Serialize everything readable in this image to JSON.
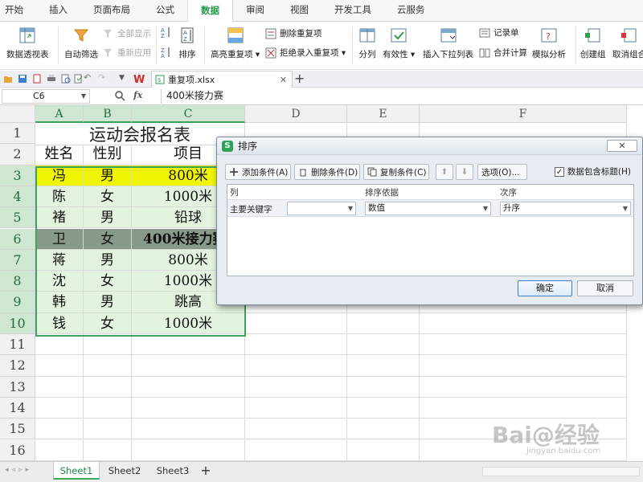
{
  "ribbon_tabs": [
    "开始",
    "插入",
    "页面布局",
    "公式",
    "数据",
    "审阅",
    "视图",
    "开发工具",
    "云服务"
  ],
  "ribbon": {
    "pivot": "数据透视表",
    "autofilter": "自动筛选",
    "show_all": "全部显示",
    "reapply": "重新应用",
    "sort": "排序",
    "highlight_dup": "高亮重复项",
    "delete_dup": "删除重复项",
    "reject_dup": "拒绝录入重复项",
    "split": "分列",
    "validity": "有效性",
    "dropdown_list": "插入下拉列表",
    "record": "记录单",
    "consolidate": "合并计算",
    "simulate": "模拟分析",
    "create_group": "创建组",
    "ungroup": "取消组合"
  },
  "document": {
    "tab_name": "重复项.xlsx"
  },
  "formula_bar": {
    "cell_ref": "C6",
    "fx": "fx",
    "value": "400米接力赛"
  },
  "sheet": {
    "columns": [
      "A",
      "B",
      "C",
      "D",
      "E",
      "F"
    ],
    "rows": [
      "1",
      "2",
      "3",
      "4",
      "5",
      "6",
      "7",
      "8",
      "9",
      "10",
      "11",
      "12",
      "13",
      "14",
      "15",
      "16"
    ],
    "title": "运动会报名表",
    "headers": [
      "姓名",
      "性别",
      "项目"
    ],
    "data": [
      [
        "冯",
        "男",
        "800米"
      ],
      [
        "陈",
        "女",
        "1000米"
      ],
      [
        "褚",
        "男",
        "铅球"
      ],
      [
        "卫",
        "女",
        "400米接力赛"
      ],
      [
        "蒋",
        "男",
        "800米"
      ],
      [
        "沈",
        "女",
        "1000米"
      ],
      [
        "韩",
        "男",
        "跳高"
      ],
      [
        "钱",
        "女",
        "1000米"
      ]
    ],
    "colors": {
      "highlight_yellow": "#f0f600",
      "highlight_gray": "#8a9a8a",
      "band_green": "#e3f3df"
    }
  },
  "sheet_tabs": [
    "Sheet1",
    "Sheet2",
    "Sheet3"
  ],
  "dialog": {
    "title": "排序",
    "add_condition": "添加条件(A)",
    "delete_condition": "删除条件(D)",
    "copy_condition": "复制条件(C)",
    "options": "选项(O)...",
    "has_header": "数据包含标题(H)",
    "col_header": "列",
    "sort_on_header": "排序依据",
    "order_header": "次序",
    "row_label": "主要关键字",
    "column_value": "",
    "sort_on_value": "数值",
    "order_value": "升序",
    "ok": "确定",
    "cancel": "取消"
  },
  "watermark": {
    "text": "Bai@经验",
    "url": "jingyan.baidu.com"
  }
}
